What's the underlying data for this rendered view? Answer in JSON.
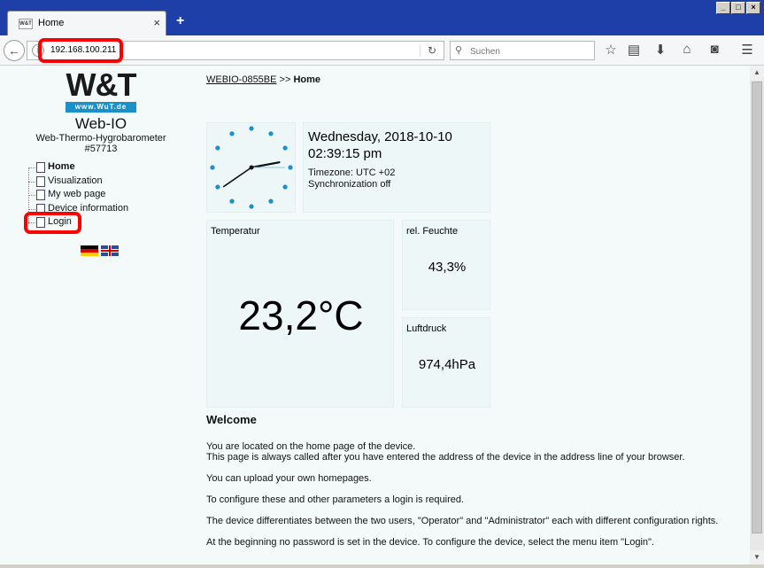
{
  "browser": {
    "tab_title": "Home",
    "tab_close": "×",
    "new_tab": "+",
    "url": "192.168.100.211",
    "search_placeholder": "Suchen",
    "window_buttons": [
      "_",
      "□",
      "×"
    ]
  },
  "sidebar": {
    "logo_text": "W&T",
    "logo_url": "www.WuT.de",
    "brand": "Web-IO",
    "subtitle": "Web-Thermo-Hygrobarometer",
    "model": "#57713",
    "menu": [
      {
        "label": "Home"
      },
      {
        "label": "Visualization"
      },
      {
        "label": "My web page"
      },
      {
        "label": "Device information"
      },
      {
        "label": "Login"
      }
    ]
  },
  "breadcrumb": {
    "device": "WEBIO-0855BE",
    "separator": ">>",
    "current": "Home"
  },
  "clock": {
    "time": "02:39:15"
  },
  "datetime": {
    "date": "Wednesday, 2018-10-10",
    "time": "02:39:15 pm",
    "timezone": "Timezone: UTC +02",
    "sync": "Synchronization off"
  },
  "sensors": {
    "temperature": {
      "label": "Temperatur",
      "value": "23,2°C"
    },
    "humidity": {
      "label": "rel. Feuchte",
      "value": "43,3%"
    },
    "pressure": {
      "label": "Luftdruck",
      "value": "974,4hPa"
    }
  },
  "welcome": {
    "heading": "Welcome",
    "p1a": "You are located on the home page of the device.",
    "p1b": "This page is always called after you have entered the address of the device in the address line of your browser.",
    "p2": "You can upload your own homepages.",
    "p3": "To configure these and other parameters a login is required.",
    "p4": "The device differentiates between the two users, \"Operator\" and \"Administrator\" each with different configuration rights.",
    "p5": "At the beginning no password is set in the device. To configure the device, select the menu item \"Login\"."
  },
  "colors": {
    "titlebar": "#1e3fa8",
    "content_bg": "#f4fafa",
    "clock_dot": "#1a8fc8",
    "highlight": "#ff0000"
  }
}
